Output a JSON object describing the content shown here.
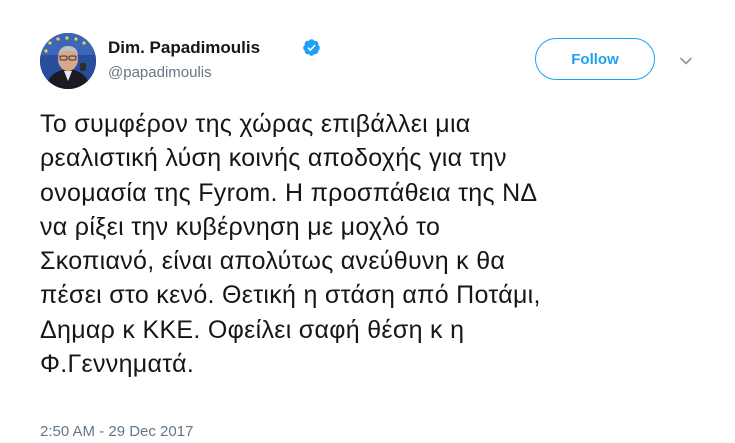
{
  "author": {
    "display_name": "Dim. Papadimoulis",
    "handle": "@papadimoulis",
    "verified": true,
    "verified_icon": "verified-badge-icon",
    "avatar_icon": "profile-photo"
  },
  "actions": {
    "follow_label": "Follow",
    "menu_icon": "chevron-down-icon"
  },
  "tweet": {
    "lines": [
      "Το συμφέρον της χώρας επιβάλλει μια",
      "ρεαλιστική λύση κοινής αποδοχής για την",
      "ονομασία της Fyrom. Η προσπάθεια της ΝΔ",
      "να ρίξει την κυβέρνηση με μοχλό το",
      "Σκοπιανό, είναι απολύτως ανεύθυνη κ θα",
      "πέσει στο κενό. Θετική η στάση από Ποτάμι,",
      "Δημαρ κ ΚΚΕ. Οφείλει σαφή θέση κ η",
      "Φ.Γεννηματά."
    ],
    "timestamp": "2:50 AM - 29 Dec 2017"
  },
  "colors": {
    "accent": "#1da1f2",
    "text": "#14171a",
    "secondary": "#657786"
  }
}
